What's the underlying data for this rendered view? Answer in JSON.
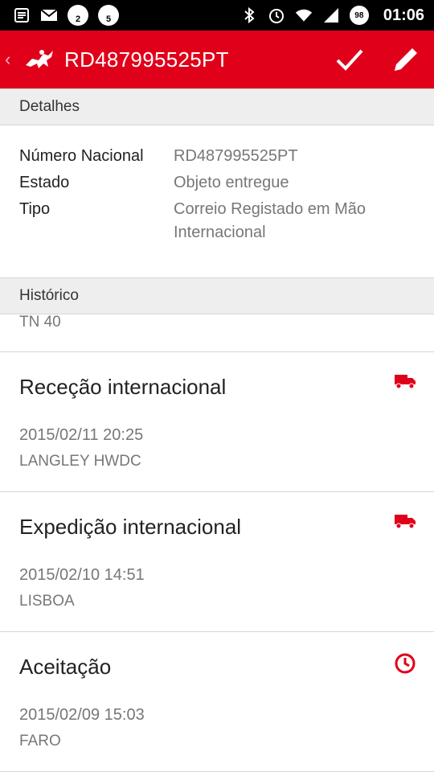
{
  "status_bar": {
    "notification_badges": [
      "2",
      "5"
    ],
    "battery": "98",
    "time": "01:06",
    "icons": [
      "list-icon",
      "gmail-icon",
      "whatsapp-icon",
      "whatsapp-icon",
      "bluetooth-icon",
      "alarm-icon",
      "wifi-icon",
      "signal-icon",
      "battery-icon"
    ]
  },
  "app_bar": {
    "title": "RD487995525PT",
    "color": "#e0001a",
    "actions": [
      "check-icon",
      "edit-pencil-icon"
    ]
  },
  "details": {
    "header": "Detalhes",
    "rows": [
      {
        "label": "Número Nacional",
        "value": "RD487995525PT"
      },
      {
        "label": "Estado",
        "value": "Objeto entregue"
      },
      {
        "label": "Tipo",
        "value": "Correio Registado em Mão Internacional"
      }
    ]
  },
  "history": {
    "header": "Histórico",
    "partial_line": "TN 40",
    "events": [
      {
        "title": "Receção internacional",
        "date": "2015/02/11 20:25",
        "place": "LANGLEY HWDC",
        "icon": "truck-icon"
      },
      {
        "title": "Expedição internacional",
        "date": "2015/02/10 14:51",
        "place": "LISBOA",
        "icon": "truck-icon"
      },
      {
        "title": "Aceitação",
        "date": "2015/02/09 15:03",
        "place": "FARO",
        "icon": "clock-icon"
      }
    ]
  }
}
